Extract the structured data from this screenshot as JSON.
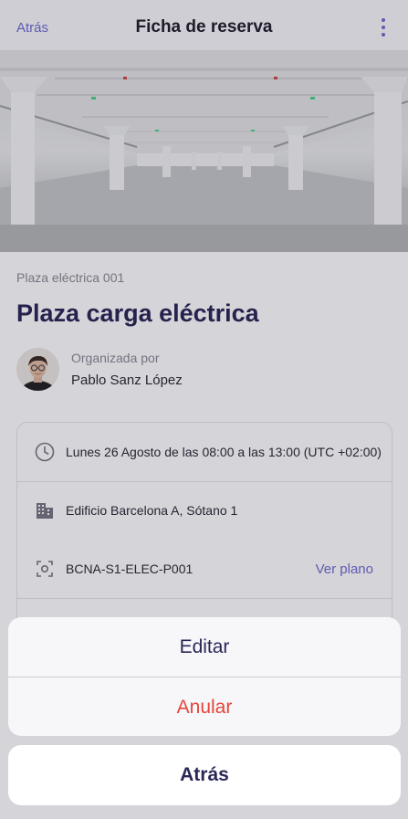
{
  "navbar": {
    "back_label": "Atrás",
    "title": "Ficha de reserva",
    "more_icon": "more-vertical-icon",
    "accent": "#6f6cd0"
  },
  "hero": {
    "image": "parking-garage-photo"
  },
  "booking": {
    "code": "Plaza eléctrica 001",
    "title": "Plaza carga eléctrica",
    "organizer_label": "Organizada por",
    "organizer_name": "Pablo Sanz López"
  },
  "details": [
    {
      "icon": "clock-icon",
      "text": "Lunes 26 Agosto de las 08:00 a las 13:00 (UTC +02:00)"
    },
    {
      "icon": "building-icon",
      "text": "Edificio Barcelona A, Sótano 1"
    },
    {
      "icon": "scan-icon",
      "text": "BCNA-S1-ELEC-P001",
      "link": "Ver plano"
    }
  ],
  "action_sheet": {
    "edit_label": "Editar",
    "cancel_booking_label": "Anular",
    "dismiss_label": "Atrás",
    "colors": {
      "primary": "#2a2757",
      "destructive": "#e5453b"
    }
  }
}
